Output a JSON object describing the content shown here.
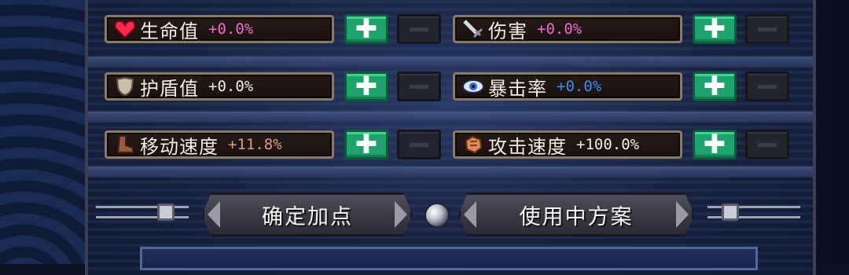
{
  "stats": [
    {
      "label": "生命值",
      "value": "+0.0%",
      "value_color": "#ee6bd0",
      "icon": "heart-icon"
    },
    {
      "label": "伤害",
      "value": "+0.0%",
      "value_color": "#ee6bd0",
      "icon": "sword-icon"
    },
    {
      "label": "护盾值",
      "value": "+0.0%",
      "value_color": "#f2ece4",
      "icon": "shield-icon"
    },
    {
      "label": "暴击率",
      "value": "+0.0%",
      "value_color": "#3d8cf2",
      "icon": "eye-icon"
    },
    {
      "label": "移动速度",
      "value": "+11.8%",
      "value_color": "#d9a07e",
      "icon": "boot-icon"
    },
    {
      "label": "攻击速度",
      "value": "+100.0%",
      "value_color": "#f2ece4",
      "icon": "fist-icon"
    }
  ],
  "buttons": {
    "confirm": "确定加点",
    "active_plan": "使用中方案",
    "plus_glyph": "✚"
  },
  "colors": {
    "plus": "#1fa36c",
    "minus": "#23252c",
    "frame": "#8a7a64"
  }
}
